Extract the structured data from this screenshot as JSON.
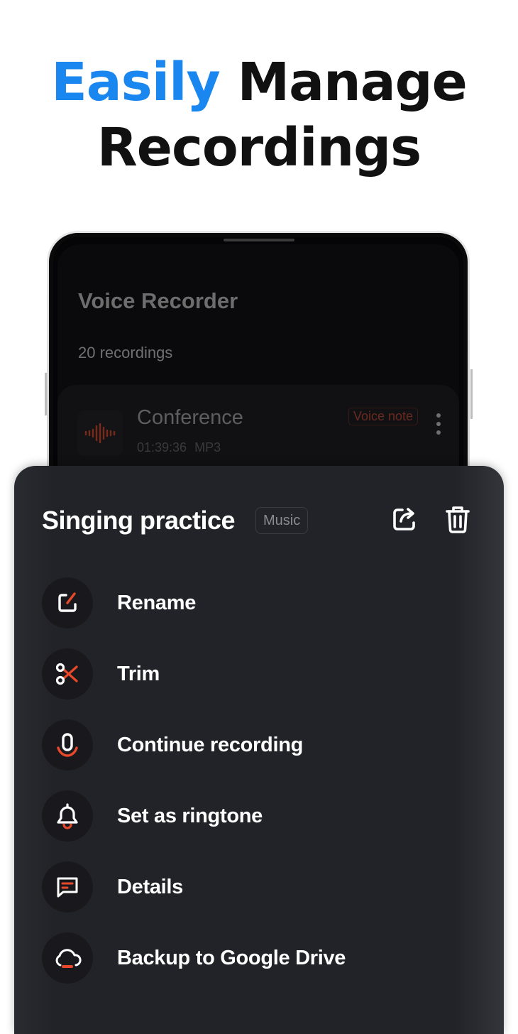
{
  "headline": {
    "accent": "Easily",
    "rest": "Manage",
    "line2": "Recordings"
  },
  "colors": {
    "accent_blue": "#1a86f0",
    "accent_red": "#e8492a",
    "sheet_bg": "#222328"
  },
  "app": {
    "title": "Voice Recorder",
    "count": "20 recordings",
    "recording": {
      "name": "Conference",
      "duration": "01:39:36",
      "format": "MP3",
      "badge": "Voice note",
      "icon": "waveform-icon"
    }
  },
  "sheet": {
    "title": "Singing practice",
    "tag": "Music",
    "actions": [
      {
        "icon": "share-icon"
      },
      {
        "icon": "trash-icon"
      }
    ],
    "items": [
      {
        "label": "Rename",
        "icon": "edit-icon"
      },
      {
        "label": "Trim",
        "icon": "scissors-icon"
      },
      {
        "label": "Continue recording",
        "icon": "microphone-icon"
      },
      {
        "label": "Set as ringtone",
        "icon": "bell-icon"
      },
      {
        "label": "Details",
        "icon": "details-icon"
      },
      {
        "label": "Backup to Google Drive",
        "icon": "cloud-upload-icon"
      }
    ]
  }
}
